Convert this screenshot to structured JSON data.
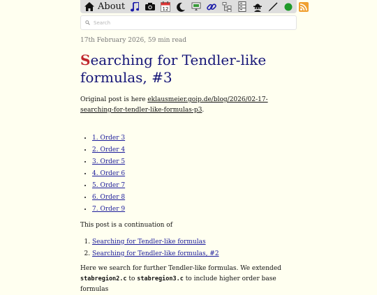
{
  "nav": {
    "about_label": "About",
    "icons": [
      "home-icon",
      "music-icon",
      "camera-icon",
      "calendar-icon",
      "moon-icon",
      "screen-icon",
      "link-icon",
      "sitemap-icon",
      "database-icon",
      "hacker-icon",
      "pen-icon",
      "green-dot-icon",
      "rss-icon"
    ],
    "calendar_day": "12"
  },
  "search": {
    "placeholder": "Search"
  },
  "post": {
    "meta": "17th February 2026, 59 min read",
    "title_initial": "S",
    "title_rest": "earching for Tendler-like formulas, #3",
    "original_prefix": "Original post is here ",
    "original_link": "eklausmeier.goip.de/blog/2026/02-17-searching-for-tendler-like-formulas-p3",
    "original_suffix": ".",
    "toc": [
      "1. Order 3",
      "2. Order 4",
      "3. Order 5",
      "4. Order 6",
      "5. Order 7",
      "6. Order 8",
      "7. Order 9"
    ],
    "continuation_text": "This post is a continuation of",
    "previous_posts": [
      "Searching for Tendler-like formulas",
      "Searching for Tendler-like formulas, #2"
    ],
    "extended_text_1": "Here we search for further Tendler-like formulas. We extended",
    "code_1": "stabregion2.c",
    "to_word": " to ",
    "code_2": "stabregion3.c",
    "extended_text_2": " to include higher order base formulas"
  },
  "colors": {
    "background": "#fffff0",
    "title": "#151577",
    "link": "#1a1a9a",
    "logo_red": "#c0272d",
    "navbar": "#dedede"
  }
}
